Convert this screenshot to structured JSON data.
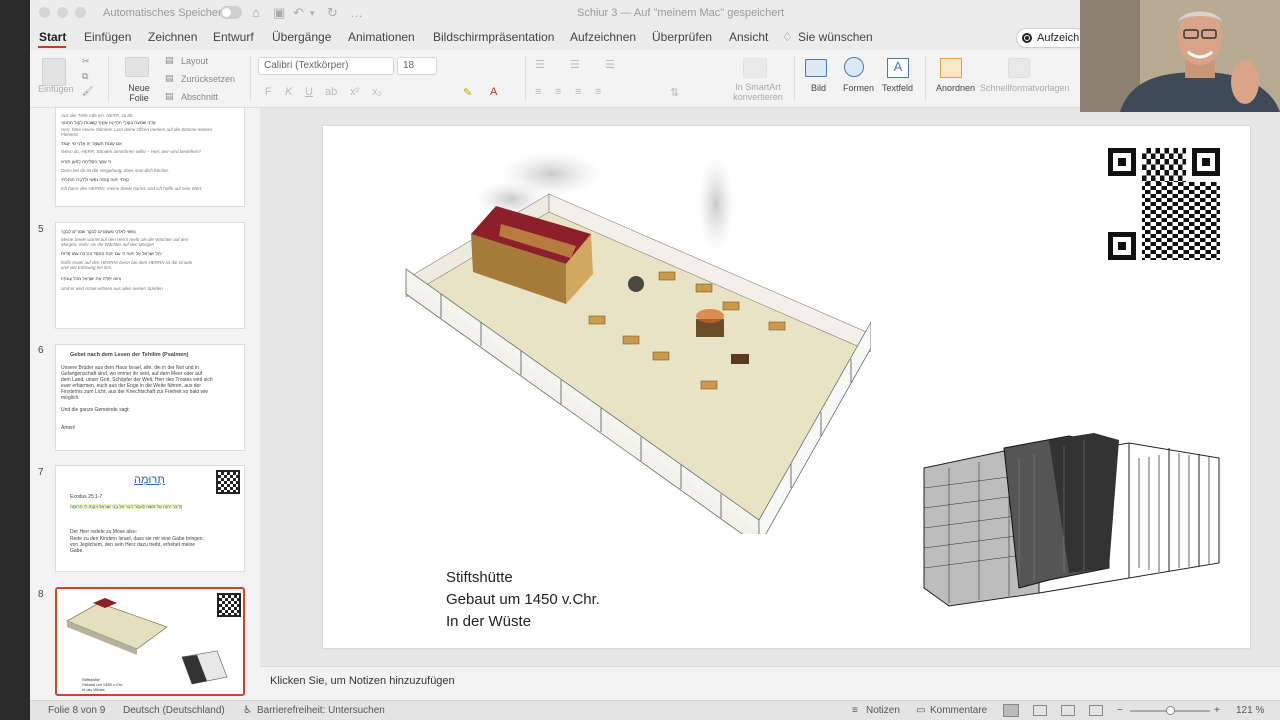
{
  "titlebar": {
    "autosave_label": "Automatisches Speichern",
    "document_title": "Schiur 3 — Auf \"meinem Mac\" gespeichert"
  },
  "tabs": [
    "Start",
    "Einfügen",
    "Zeichnen",
    "Entwurf",
    "Übergänge",
    "Animationen",
    "Bildschirmpräsentation",
    "Aufzeichnen",
    "Überprüfen",
    "Ansicht"
  ],
  "tell_me": "Sie wünschen",
  "record_button": "Aufzeichnen",
  "ribbon": {
    "paste": "Einfügen",
    "new_slide": "Neue Folie",
    "layout": "Layout",
    "reset": "Zurücksetzen",
    "section": "Abschnitt",
    "font_name": "Calibri (Textkörper)",
    "font_size": "18",
    "smartart": "In SmartArt konvertieren",
    "image": "Bild",
    "shapes": "Formen",
    "textbox": "Textfeld",
    "arrange": "Anordnen",
    "quick_styles": "Schnellformatvorlagen"
  },
  "slides": [
    {
      "number": "",
      "lines": [
        {
          "t": "Aus der Tiefe rufe ich, HERR, zu dir.",
          "s": "it"
        },
        {
          "t": "אֲדֹנָי שִׁמְעָה בְקוֹלִי תִּהְיֶינָה אָזְנֶיךָ קַשֻּׁבוֹת לְקוֹל תַּחֲנוּנָי",
          "s": ""
        },
        {
          "t": "Herr, höre meine Stimme! Lass deine Ohren merken auf die Stimme meines",
          "s": "it"
        },
        {
          "t": "Flehens!",
          "s": "it"
        },
        {
          "t": "אִם עֲוֺנוֹת תִּשְׁמָר יָהּ אֲדֹנָי מִי יַעֲמֹד׃",
          "s": ""
        },
        {
          "t": "Wenn du, HERR, Sünden anrechnen willst – Herr, wer wird bestehen?",
          "s": "it"
        },
        {
          "t": "כִּי עִמְּךָ הַסְּלִיחָה לְמַעַן תִּוָּרֵא",
          "s": ""
        },
        {
          "t": "Denn bei dir ist die Vergebung, dass man dich fürchte.",
          "s": "it"
        },
        {
          "t": "קִוִּיתִי יְהוָה קִוְּתָה נַפְשִׁי וְלִדְבָרוֹ הוֹחָלְתִּי",
          "s": ""
        },
        {
          "t": "Ich harre des HERRN, meine Seele harret, und ich hoffe auf sein Wort.",
          "s": "it"
        }
      ]
    },
    {
      "number": "5",
      "lines": [
        {
          "t": "נַפְשִׁי לַאדֹנָי מִשֹּׁמְרִים לַבֹּקֶר שֹׁמְרִים לַבֹּקֶר",
          "s": ""
        },
        {
          "t": "Meine Seele wartet auf den Herrn mehr als die Wächter auf den",
          "s": "it"
        },
        {
          "t": "Morgen, mehr als die Wächter auf den Morgen",
          "s": "it"
        },
        {
          "t": "יַחֵל יִשְׂרָאֵל אֶל יְהוָה כִּי עִם יְהוָה הַחֶסֶד וְהַרְבֵּה עִמּוֹ פְדוּת",
          "s": ""
        },
        {
          "t": "hoffe Israel auf den HERRN! Denn bei dem HERRN ist die Gnade",
          "s": "it"
        },
        {
          "t": "und viel Erlösung bei ihm.",
          "s": "it"
        },
        {
          "t": "וְהוּא יִפְדֶּה אֶת יִשְׂרָאֵל מִכֹּל עֲוֺנֹתָיו",
          "s": ""
        },
        {
          "t": "Und er wird Israel erlösen aus allen seinen Sünden",
          "s": "it"
        }
      ]
    },
    {
      "number": "6",
      "title": "Gebet nach dem Lesen der Tehilim (Psalmen)",
      "lines": [
        {
          "t": "Unsere Brüder aus dem Haus Israel, alle, die in der Not und in",
          "s": "sm"
        },
        {
          "t": "Gefangenschaft sind, wo immer ihr seid, auf dem Meer oder auf",
          "s": "sm"
        },
        {
          "t": "dem Land, unser Gott, Schöpfer der Welt, Herr des Trostes wird sich",
          "s": "sm"
        },
        {
          "t": "euer erbarmen, euch aus der Enge in die Weite führen, aus der",
          "s": "sm"
        },
        {
          "t": "Finsternis zum Licht, aus der Knechtschaft zur Freiheit so bald wie",
          "s": "sm"
        },
        {
          "t": "möglich.",
          "s": "sm"
        },
        {
          "t": "Und die ganze Gemeinde sagt:",
          "s": "sm"
        },
        {
          "t": "Amen!",
          "s": "sm"
        }
      ]
    },
    {
      "number": "7",
      "title": "תְּרוּמָה",
      "ref": "Exodus 25:1-7",
      "hebrew_line": "וַיְדַבֵּר יְהוָה אֶל מֹשֶׁה לֵּאמֹר׃ דַּבֵּר אֶל בְּנֵי יִשְׂרָאֵל וְיִקְחוּ לִי תְּרוּמָה",
      "lines": [
        {
          "t": "Der Herr redete zu Mose also:",
          "s": "sm"
        },
        {
          "t": "Rede zu den Kindern Israel, dass sie mir eine Gabe bringen,",
          "s": "sm"
        },
        {
          "t": "von Jeglichem, den sein Herz dazu treibt, erhebet meine",
          "s": "sm"
        },
        {
          "t": "Gabe.",
          "s": "sm"
        }
      ]
    },
    {
      "number": "8",
      "caption_lines": [
        "Stiftshütte",
        "Gebaut um 1450 v.Chr.",
        "In der Wüste"
      ]
    }
  ],
  "main_slide": {
    "caption_lines": [
      "Stiftshütte",
      "Gebaut um 1450 v.Chr.",
      "In der Wüste"
    ]
  },
  "notes_placeholder": "Klicken Sie, um Notizen hinzuzufügen",
  "status": {
    "slide_info": "Folie 8 von 9",
    "language": "Deutsch (Deutschland)",
    "accessibility": "Barrierefreiheit: Untersuchen",
    "notes": "Notizen",
    "comments": "Kommentare",
    "zoom": "121 %"
  },
  "colors": {
    "accent": "#c43e1c",
    "selection": "#c9462c"
  }
}
